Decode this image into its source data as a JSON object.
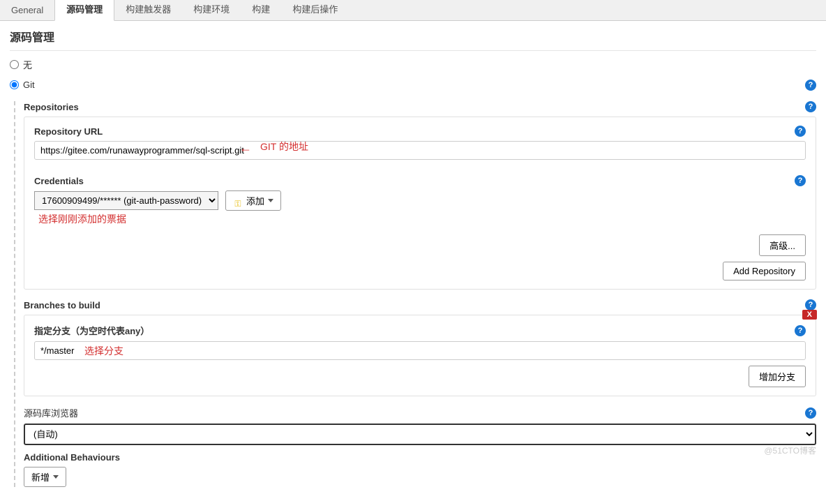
{
  "tabs": {
    "general": "General",
    "scm": "源码管理",
    "triggers": "构建触发器",
    "env": "构建环境",
    "build": "构建",
    "post": "构建后操作"
  },
  "section": {
    "title": "源码管理",
    "none_label": "无",
    "git_label": "Git"
  },
  "repositories": {
    "label": "Repositories",
    "url_label": "Repository URL",
    "url_value": "https://gitee.com/runawayprogrammer/sql-script.git",
    "credentials_label": "Credentials",
    "credentials_value": "17600909499/****** (git-auth-password)",
    "add_label": "添加",
    "advanced_label": "高级...",
    "add_repo_label": "Add Repository"
  },
  "annotations": {
    "git_url": "GIT 的地址",
    "credentials": "选择刚刚添加的票据",
    "branch": "选择分支"
  },
  "branches": {
    "label": "Branches to build",
    "specifier_label": "指定分支（为空时代表any）",
    "value": "*/master",
    "add_label": "增加分支",
    "delete": "X"
  },
  "browser": {
    "label": "源码库浏览器",
    "value": "(自动)"
  },
  "additional": {
    "label": "Additional Behaviours",
    "add_label": "新增"
  },
  "watermark": "@51CTO博客"
}
